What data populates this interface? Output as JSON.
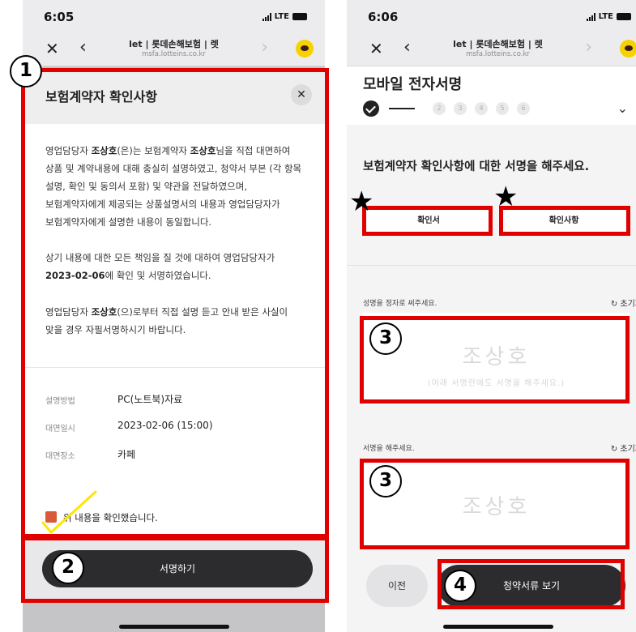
{
  "left": {
    "status": {
      "time": "6:05",
      "network": "LTE"
    },
    "browser": {
      "title": "let | 롯데손해보험 | 렛",
      "url": "msfa.lotteins.co.kr"
    },
    "modal": {
      "title": "보험계약자 확인사항",
      "para1": [
        "영업담당자 조상호(은)는 보험계약자 조상호님을 직접 대면하여",
        "상품 및 계약내용에 대해 충실히 설명하였고, 청약서 부본 (각 항목",
        "설명, 확인 및 동의서 포함) 및 약관을 전달하였으며,",
        "보험계약자에게 제공되는 상품설명서의 내용과 영업담당자가",
        "보험계약자에게 설명한 내용이 동일합니다."
      ],
      "para2": [
        "상기 내용에 대한 모든 책임을 질 것에 대하여 영업담당자가",
        "2023-02-06에 확인 및 서명하였습니다."
      ],
      "para3": [
        "영업담당자 조상호(으)로부터 직접 설명 듣고 안내 받은 사실이",
        "맞을 경우 자필서명하시기 바랍니다."
      ],
      "info": [
        {
          "label": "설명방법",
          "value": "PC(노트북)자료"
        },
        {
          "label": "대면일시",
          "value": "2023-02-06 (15:00)"
        },
        {
          "label": "대면장소",
          "value": "카페"
        }
      ],
      "confirm_label": "위 내용을 확인했습니다.",
      "confirm_checked": true,
      "sign_button": "서명하기"
    }
  },
  "right": {
    "status": {
      "time": "6:06",
      "network": "LTE"
    },
    "browser": {
      "title": "let | 롯데손해보험 | 렛",
      "url": "msfa.lotteins.co.kr"
    },
    "page_title": "모바일 전자서명",
    "steps": [
      "2",
      "3",
      "4",
      "5",
      "6"
    ],
    "headline": "보험계약자 확인사항에 대한 서명을 해주세요.",
    "tabs": [
      "확인서",
      "확인사항"
    ],
    "pad1": {
      "label": "성명을 정자로 써주세요.",
      "reset": "초기화",
      "ghost": "조상호",
      "hint": "(아래 서명란에도 서명을 해주세요.)"
    },
    "pad2": {
      "label": "서명을 해주세요.",
      "reset": "초기화",
      "ghost": "조상호"
    },
    "prev_button": "이전",
    "next_button": "청약서류 보기"
  },
  "annotations": {
    "badge1": "1",
    "badge2": "2",
    "badge3a": "3",
    "badge3b": "3",
    "badge4": "4"
  },
  "colors": {
    "highlight": "#e00000",
    "primary_button": "#2c2c2e",
    "checkbox": "#d95a3b",
    "kakao": "#f6d200"
  }
}
